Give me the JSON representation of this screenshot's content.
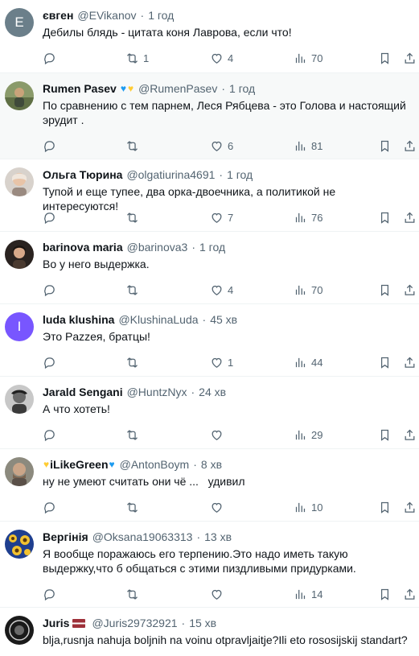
{
  "colors": {
    "meta": "#536471",
    "text": "#0f1419",
    "divider": "#eff3f4",
    "highlight": "#f7f9f9",
    "heart_blue": "#1d9bf0",
    "heart_yellow": "#ffcc33"
  },
  "tweets": [
    {
      "name": "євген",
      "handle": "@EVikanov",
      "sep": "·",
      "time": "1 год",
      "text": "Дебилы блядь - цитата коня Лаврова, если что!",
      "avatar_letter": "E",
      "avatar_color": "#6b7f8a",
      "replies": "",
      "retweets": "1",
      "likes": "4",
      "views": "70"
    },
    {
      "name": "Rumen Pasev",
      "handle": "@RumenPasev",
      "sep": "·",
      "time": "1 год",
      "text": "По сравнению с тем парнем, Леся Рябцева - это Голова и настоящий эрудит .",
      "replies": "",
      "retweets": "",
      "likes": "6",
      "views": "81"
    },
    {
      "name": "Ольга Тюрина",
      "handle": "@olgatiurina4691",
      "sep": "·",
      "time": "1 год",
      "text": "Тупой и еще тупее, два орка-двоечника, а политикой не интересуются!",
      "replies": "",
      "retweets": "",
      "likes": "7",
      "views": "76"
    },
    {
      "name": "barinova maria",
      "handle": "@barinova3",
      "sep": "·",
      "time": "1 год",
      "text": "Во у него выдержка.",
      "replies": "",
      "retweets": "",
      "likes": "4",
      "views": "70"
    },
    {
      "name": "luda klushina",
      "handle": "@KlushinaLuda",
      "sep": "·",
      "time": "45 хв",
      "text": "Это Pazzeя, братцы!",
      "avatar_letter": "I",
      "avatar_color": "#7856ff",
      "replies": "",
      "retweets": "",
      "likes": "1",
      "views": "44"
    },
    {
      "name": "Jarald Sengani",
      "handle": "@HuntzNyx",
      "sep": "·",
      "time": "24 хв",
      "text": "А что хотеть!",
      "replies": "",
      "retweets": "",
      "likes": "",
      "views": "29"
    },
    {
      "name": "iLikeGreen",
      "handle": "@AntonBoym",
      "sep": "·",
      "time": "8 хв",
      "text": "ну не умеют считать они чё ...   удивил",
      "replies": "",
      "retweets": "",
      "likes": "",
      "views": "10"
    },
    {
      "name": "Вергінія",
      "handle": "@Oksana19063313",
      "sep": "·",
      "time": "13 хв",
      "text": "Я вообще поражаюсь его терпению.Это надо иметь такую выдержку,что б общаться с этими пиздливыми  придурками.",
      "replies": "",
      "retweets": "",
      "likes": "",
      "views": "14"
    },
    {
      "name": "Juris",
      "handle": "@Juris29732921",
      "sep": "·",
      "time": "15 хв",
      "text": "blja,rusnja nahuja boljnih na voinu otpravljaitje?Ili eto rososijskij standart?"
    }
  ],
  "icons": {
    "reply": "reply-icon",
    "retweet": "retweet-icon",
    "like": "heart-icon",
    "views": "views-icon",
    "bookmark": "bookmark-icon",
    "share": "share-icon"
  }
}
